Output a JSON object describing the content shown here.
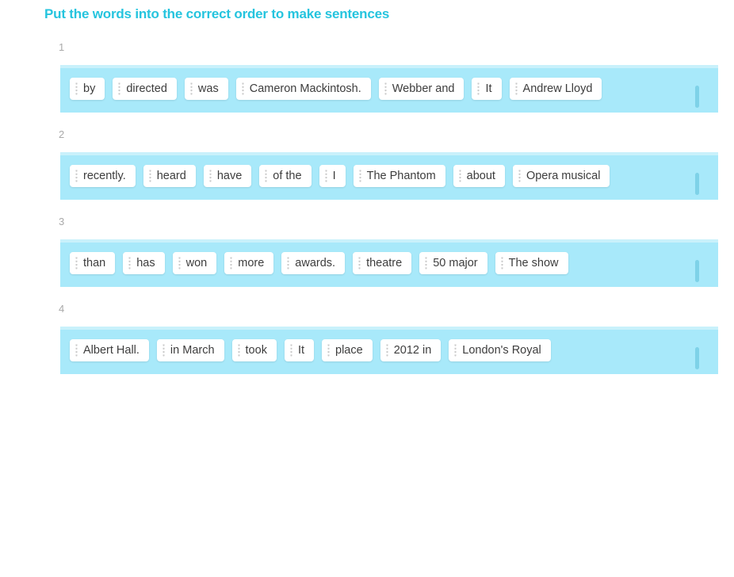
{
  "exercise": {
    "title": "Put the words into the correct order to make sentences",
    "title_color": "#25c4de",
    "bank_color": "#a8e9fa",
    "chip_color": "#ffffff",
    "handle_color": "#7ed2e8"
  },
  "questions": [
    {
      "number": "1",
      "words": [
        "by",
        "directed",
        "was",
        "Cameron Mackintosh.",
        "Webber and",
        "It",
        "Andrew Lloyd"
      ]
    },
    {
      "number": "2",
      "words": [
        "recently.",
        "heard",
        "have",
        "of the",
        "I",
        "The Phantom",
        "about",
        "Opera musical"
      ]
    },
    {
      "number": "3",
      "words": [
        "than",
        "has",
        "won",
        "more",
        "awards.",
        "theatre",
        "50 major",
        "The show"
      ]
    },
    {
      "number": "4",
      "words": [
        "Albert Hall.",
        "in March",
        "took",
        "It",
        "place",
        "2012 in",
        "London's Royal"
      ]
    }
  ]
}
